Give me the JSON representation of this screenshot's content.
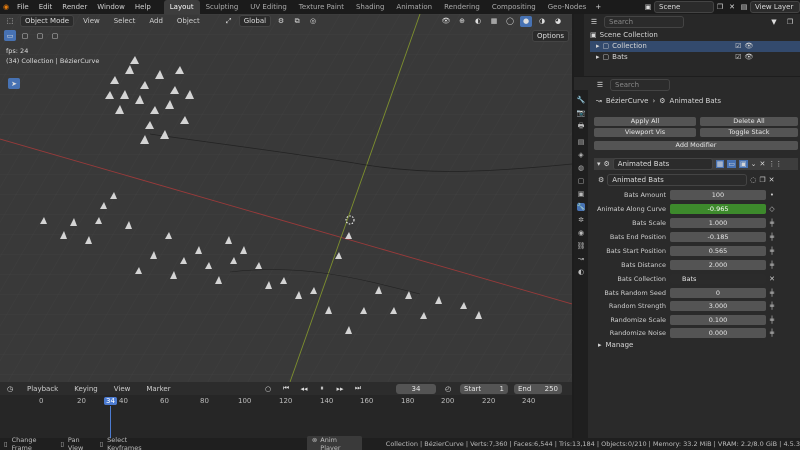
{
  "topbar": {
    "menus": [
      "File",
      "Edit",
      "Render",
      "Window",
      "Help"
    ],
    "tabs": [
      "Layout",
      "Sculpting",
      "UV Editing",
      "Texture Paint",
      "Shading",
      "Animation",
      "Rendering",
      "Compositing",
      "Geo-Nodes"
    ],
    "active_tab": "Layout",
    "scene": "Scene",
    "view_layer": "View Layer"
  },
  "viewport": {
    "mode": "Object Mode",
    "menus": [
      "View",
      "Select",
      "Add",
      "Object"
    ],
    "orientation": "Global",
    "options_label": "Options",
    "fps": "fps: 24",
    "info": "(34) Collection | BézierCurve"
  },
  "timeline": {
    "menus": [
      "Playback",
      "Keying",
      "View",
      "Marker"
    ],
    "current_frame": "34",
    "start_label": "Start",
    "start": "1",
    "end_label": "End",
    "end": "250",
    "ticks": [
      "0",
      "20",
      "34",
      "40",
      "60",
      "80",
      "100",
      "120",
      "140",
      "160",
      "180",
      "200",
      "220",
      "240"
    ]
  },
  "status": {
    "hints": [
      "Change Frame",
      "Pan View",
      "Select Keyframes"
    ],
    "anim_player": "Anim Player",
    "stats": "Collection | BézierCurve | Verts:7,360 | Faces:6,544 | Tris:13,184 | Objects:0/210 | Memory: 33.2 MiB | VRAM: 2.2/8.0 GiB | 4.5.3"
  },
  "outliner": {
    "search_placeholder": "Search",
    "root": "Scene Collection",
    "items": [
      "Collection",
      "Bats"
    ]
  },
  "properties": {
    "search_placeholder": "Search",
    "breadcrumb": [
      "BézierCurve",
      "Animated Bats"
    ],
    "apply_all": "Apply All",
    "delete_all": "Delete All",
    "viewport_vis": "Viewport Vis",
    "toggle_stack": "Toggle Stack",
    "add_modifier": "Add Modifier",
    "modifier_name": "Animated Bats",
    "node_group": "Animated Bats",
    "fields": [
      {
        "label": "Bats Amount",
        "value": "100"
      },
      {
        "label": "Animate Along Curve",
        "value": "-0.965"
      },
      {
        "label": "Bats Scale",
        "value": "1.000"
      },
      {
        "label": "Bats End Position",
        "value": "-0.185"
      },
      {
        "label": "Bats Start Position",
        "value": "0.565"
      },
      {
        "label": "Bats Distance",
        "value": "2.000"
      },
      {
        "label": "Bats Collection",
        "value": "Bats"
      },
      {
        "label": "Bats Random Seed",
        "value": "0"
      },
      {
        "label": "Random Strength",
        "value": "3.000"
      },
      {
        "label": "Randomize Scale",
        "value": "0.100"
      },
      {
        "label": "Randomize Noise",
        "value": "0.000"
      }
    ],
    "manage": "Manage"
  },
  "colors": {
    "accent": "#4772b3",
    "keyed_green": "#3d8a2c",
    "playhead": "#4c7bd1"
  }
}
